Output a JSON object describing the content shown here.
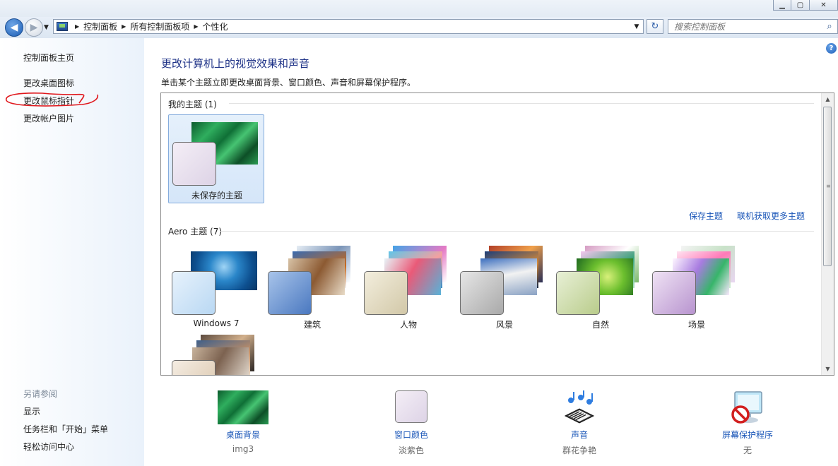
{
  "window": {
    "controls": [
      "minimize",
      "maximize",
      "close"
    ]
  },
  "address": {
    "breadcrumb": [
      "控制面板",
      "所有控制面板项",
      "个性化"
    ],
    "search_placeholder": "搜索控制面板"
  },
  "sidebar": {
    "items": [
      {
        "label": "控制面板主页"
      },
      {
        "label": "更改桌面图标"
      },
      {
        "label": "更改鼠标指针"
      },
      {
        "label": "更改帐户图片"
      }
    ],
    "see_also_title": "另请参阅",
    "see_also": [
      {
        "label": "显示"
      },
      {
        "label": "任务栏和「开始」菜单"
      },
      {
        "label": "轻松访问中心"
      }
    ]
  },
  "main": {
    "title": "更改计算机上的视觉效果和声音",
    "subtitle": "单击某个主题立即更改桌面背景、窗口颜色、声音和屏幕保护程序。",
    "my_themes": {
      "label": "我的主题 (1)",
      "themes": [
        {
          "name": "未保存的主题",
          "selected": true
        }
      ]
    },
    "actions": {
      "save": "保存主题",
      "online": "联机获取更多主题"
    },
    "aero_themes": {
      "label": "Aero 主题 (7)",
      "themes": [
        {
          "name": "Windows 7"
        },
        {
          "name": "建筑"
        },
        {
          "name": "人物"
        },
        {
          "name": "风景"
        },
        {
          "name": "自然"
        },
        {
          "name": "场景"
        },
        {
          "name": ""
        }
      ]
    }
  },
  "settings": [
    {
      "name": "桌面背景",
      "value": "img3",
      "icon": "desktop-background-icon"
    },
    {
      "name": "窗口颜色",
      "value": "淡紫色",
      "icon": "window-color-icon"
    },
    {
      "name": "声音",
      "value": "群花争艳",
      "icon": "sound-icon"
    },
    {
      "name": "屏幕保护程序",
      "value": "无",
      "icon": "screensaver-icon"
    }
  ],
  "colors": {
    "link": "#1a56b8",
    "title": "#1e3287",
    "selected_bg": "#d5e6f9",
    "annotation": "#e0161b"
  }
}
